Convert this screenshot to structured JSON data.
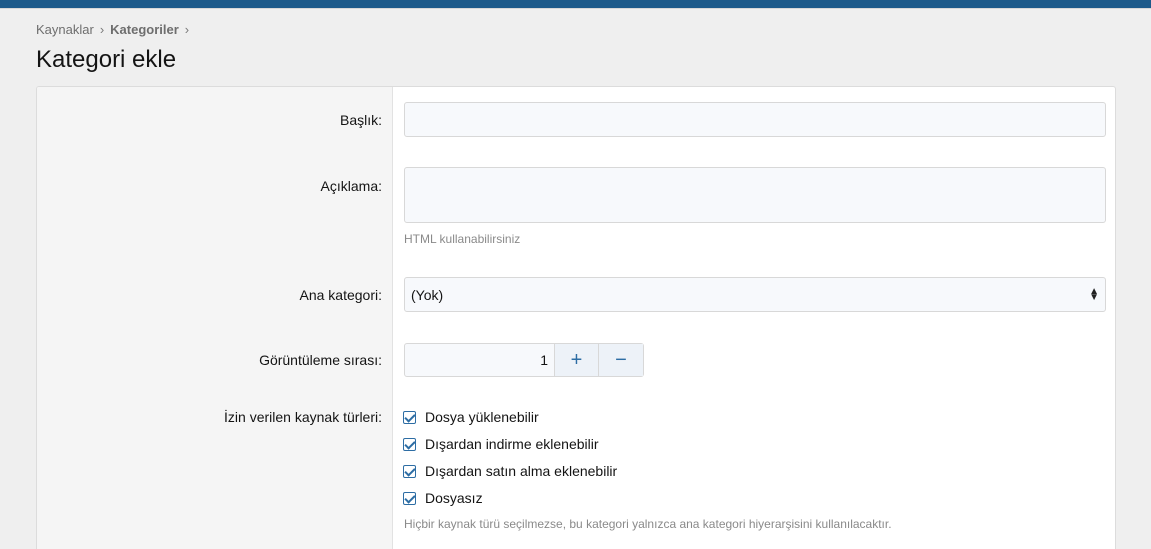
{
  "breadcrumb": [
    {
      "label": "Kaynaklar"
    },
    {
      "label": "Kategoriler"
    }
  ],
  "breadcrumb_separator": "›",
  "page_title": "Kategori ekle",
  "form": {
    "title_label": "Başlık:",
    "title_value": "",
    "description_label": "Açıklama:",
    "description_value": "",
    "description_hint": "HTML kullanabilirsiniz",
    "parent_label": "Ana kategori:",
    "parent_value": "(Yok)",
    "order_label": "Görüntüleme sırası:",
    "order_value": "1",
    "order_plus": "+",
    "order_minus": "−",
    "types_label": "İzin verilen kaynak türleri:",
    "types": [
      {
        "label": "Dosya yüklenebilir",
        "checked": true
      },
      {
        "label": "Dışardan indirme eklenebilir",
        "checked": true
      },
      {
        "label": "Dışardan satın alma eklenebilir",
        "checked": true
      },
      {
        "label": "Dosyasız",
        "checked": true
      }
    ],
    "types_hint": "Hiçbir kaynak türü seçilmezse, bu kategori yalnızca ana kategori hiyerarşisini kullanılacaktır."
  },
  "colors": {
    "header_bar": "#1d5a8a",
    "accent": "#2d6da4"
  },
  "icons": {
    "checkbox": "check-icon",
    "select": "select-arrows-icon"
  }
}
